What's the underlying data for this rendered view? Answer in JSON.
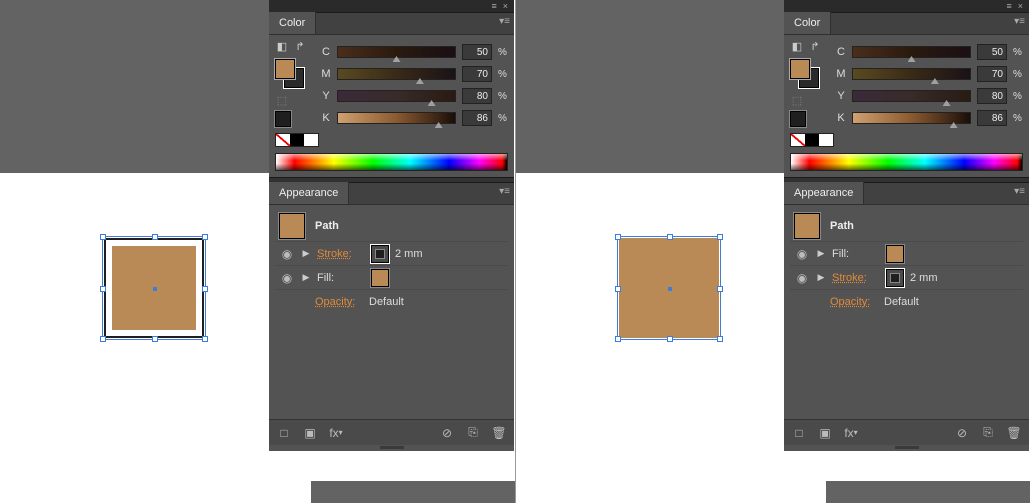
{
  "panels": {
    "color_title": "Color",
    "appearance_title": "Appearance",
    "channels": [
      {
        "label": "C",
        "value": "50",
        "thumb_pct": 50
      },
      {
        "label": "M",
        "value": "70",
        "thumb_pct": 70
      },
      {
        "label": "Y",
        "value": "80",
        "thumb_pct": 80
      },
      {
        "label": "K",
        "value": "86",
        "thumb_pct": 86
      }
    ],
    "percent": "%",
    "path_label": "Path",
    "stroke_label": "Stroke:",
    "fill_label": "Fill:",
    "stroke_value": "2 mm",
    "opacity_label": "Opacity:",
    "opacity_value": "Default",
    "fx_label": "fx"
  },
  "left": {
    "appearance_order": "stroke_first",
    "fill_color": "#ba8a56",
    "stroke_color": "#1f1f1f"
  },
  "right": {
    "appearance_order": "fill_first",
    "fill_color": "#ba8a56",
    "stroke_color": "#1f1f1f"
  }
}
